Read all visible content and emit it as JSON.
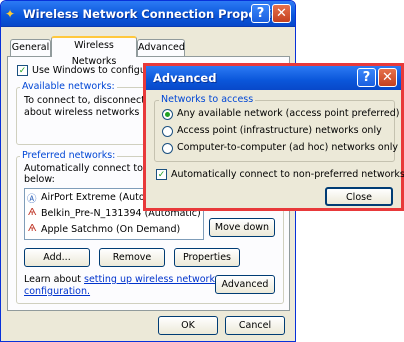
{
  "main_window": {
    "title": "Wireless Network Connection Properties",
    "help_label": "?",
    "close_label": "✕",
    "tabs": [
      {
        "label": "General"
      },
      {
        "label": "Wireless Networks"
      },
      {
        "label": "Advanced"
      }
    ],
    "use_windows_checkbox": {
      "label": "Use Windows to configure m",
      "checked": true
    },
    "available_networks": {
      "label": "Available networks:",
      "description_line1": "To connect to, disconnect from",
      "description_line2": "about wireless networks in ran"
    },
    "preferred_networks": {
      "label": "Preferred networks:",
      "description_line1": "Automatically connect to availa",
      "description_line2": "below:",
      "items": [
        {
          "name": "AirPort Extreme (Automati"
        },
        {
          "name": "Belkin_Pre-N_131394 (Automatic)"
        },
        {
          "name": "Apple Satchmo (On Demand)"
        }
      ]
    },
    "move_down_label": "Move down",
    "add_label": "Add...",
    "remove_label": "Remove",
    "properties_label": "Properties",
    "learn_about_text": "Learn about",
    "learn_link_line1": "setting up wireless network",
    "learn_link_line2": "configuration.",
    "advanced_label": "Advanced",
    "ok_label": "OK",
    "cancel_label": "Cancel"
  },
  "advanced_dialog": {
    "title": "Advanced",
    "help_label": "?",
    "close_label": "✕",
    "group_label": "Networks to access",
    "options": [
      {
        "label": "Any available network (access point preferred)",
        "selected": true
      },
      {
        "label": "Access point (infrastructure) networks only",
        "selected": false
      },
      {
        "label": "Computer-to-computer (ad hoc) networks only",
        "selected": false
      }
    ],
    "auto_connect": {
      "label": "Automatically connect to non-preferred networks",
      "checked": true
    },
    "close_button_label": "Close"
  },
  "colors": {
    "highlight_border": "#e8393a",
    "titlebar_blue": "#0a56da",
    "group_label_blue": "#0046d5"
  }
}
